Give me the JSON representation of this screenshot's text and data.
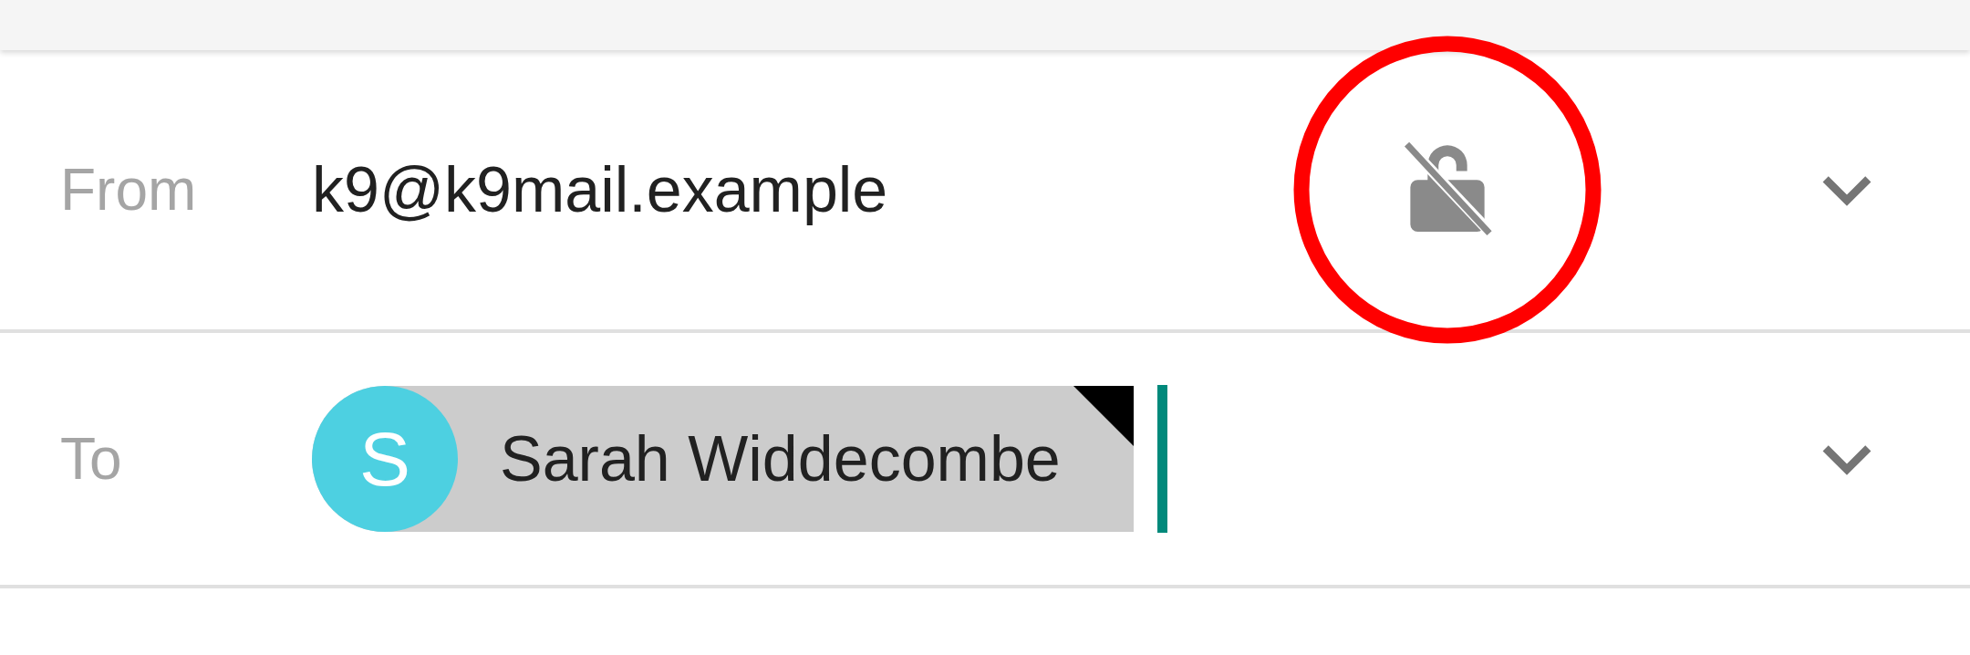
{
  "fields": [
    {
      "kind": "from",
      "label": "From",
      "value": "k9@k9mail.example",
      "crypto_icon": {
        "highlighted": true
      }
    },
    {
      "kind": "recipients",
      "label": "To",
      "chips": [
        {
          "initial": "S",
          "name": "Sarah Widdecombe",
          "color": "#4dd0e1"
        }
      ]
    }
  ]
}
